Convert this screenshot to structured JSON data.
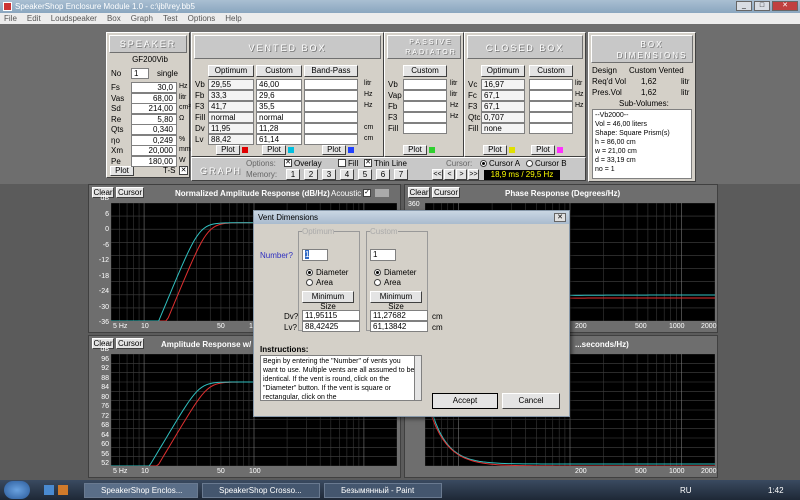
{
  "window": {
    "title": "SpeakerShop Enclosure Module 1.0 - c:\\jbl\\rey.bb5"
  },
  "menu": [
    "File",
    "Edit",
    "Loudspeaker",
    "Box",
    "Graph",
    "Test",
    "Options",
    "Help"
  ],
  "speaker": {
    "header": "SPEAKER",
    "name": "GF200Vib",
    "no_label": "No",
    "no_val": "1",
    "single": "single",
    "params": [
      {
        "k": "Fs",
        "v": "30,0",
        "u": "Hz"
      },
      {
        "k": "Vas",
        "v": "68,00",
        "u": "litr"
      },
      {
        "k": "Sd",
        "v": "214,00",
        "u": "cm²"
      },
      {
        "k": "Re",
        "v": "5,80",
        "u": "Ω"
      },
      {
        "k": "Qts",
        "v": "0,340",
        "u": ""
      },
      {
        "k": "ηo",
        "v": "0,249",
        "u": "%"
      },
      {
        "k": "Xm",
        "v": "20,000",
        "u": "mm"
      },
      {
        "k": "Pe",
        "v": "180,00",
        "u": "W"
      }
    ],
    "plot": "Plot",
    "ts": "T-S"
  },
  "vented": {
    "header": "VENTED BOX",
    "optimum": "Optimum",
    "custom": "Custom",
    "bandpass": "Band-Pass",
    "rows": [
      {
        "k": "Vb",
        "o": "29,55",
        "c": "46,00",
        "u": "litr"
      },
      {
        "k": "Fb",
        "o": "33,3",
        "c": "29,6",
        "u": "Hz"
      },
      {
        "k": "F3",
        "o": "41,7",
        "c": "35,5",
        "u": "Hz"
      },
      {
        "k": "Fill",
        "o": "normal",
        "c": "normal",
        "u": ""
      },
      {
        "k": "Dv",
        "o": "11,95",
        "c": "11,28",
        "u": "cm"
      },
      {
        "k": "Lv",
        "o": "88,42",
        "c": "61,14",
        "u": "cm"
      }
    ],
    "plot": "Plot"
  },
  "passive": {
    "header": "PASSIVE RADIATOR",
    "custom": "Custom",
    "rows": [
      {
        "k": "Vb",
        "u": "litr"
      },
      {
        "k": "Vap",
        "u": "litr"
      },
      {
        "k": "Fb",
        "u": "Hz"
      },
      {
        "k": "F3",
        "u": "Hz"
      },
      {
        "k": "Fill",
        "u": ""
      }
    ],
    "plot": "Plot"
  },
  "closed": {
    "header": "CLOSED BOX",
    "optimum": "Optimum",
    "custom": "Custom",
    "rows": [
      {
        "k": "Vc",
        "o": "16,97",
        "c": "",
        "u": "litr"
      },
      {
        "k": "Fc",
        "o": "67,1",
        "c": "",
        "u": "Hz"
      },
      {
        "k": "F3",
        "o": "67,1",
        "c": "",
        "u": "Hz"
      },
      {
        "k": "Qtc",
        "o": "0,707",
        "c": "",
        "u": ""
      },
      {
        "k": "Fill",
        "o": "none",
        "c": "",
        "u": ""
      }
    ],
    "plot": "Plot"
  },
  "boxdims": {
    "header": "BOX DIMENSIONS",
    "design": "Design",
    "design_val": "Custom Vented",
    "reqd": "Req'd Vol",
    "reqd_val": "1,62",
    "reqd_u": "litr",
    "pres": "Pres.Vol",
    "pres_val": "1,62",
    "pres_u": "litr",
    "subvol": "Sub-Volumes:",
    "lines": [
      "--Vb2000--",
      "Vol = 46,00 liters",
      "Shape: Square Prism(s)",
      "h = 86,00 cm",
      "w = 21,00 cm",
      "d = 33,19 cm",
      "no = 1"
    ]
  },
  "graphbar": {
    "label": "GRAPH",
    "options": "Options:",
    "overlay": "Overlay",
    "fill": "Fill",
    "thin": "Thin Line",
    "memory": "Memory:",
    "mem": [
      "1",
      "2",
      "3",
      "4",
      "5",
      "6",
      "7"
    ],
    "cursor": "Cursor:",
    "ca": "Cursor A",
    "cb": "Cursor B",
    "nav": [
      "<<",
      "<",
      ">",
      ">>"
    ],
    "readout": "18,9 ms / 29,5 Hz"
  },
  "graphs": {
    "clear": "Clear",
    "cursor": "Cursor",
    "g1": {
      "title": "Normalized Amplitude Response (dB/Hz)",
      "acoustic": "Acoustic",
      "y": [
        "dB",
        "6",
        "0",
        "-6",
        "-12",
        "-18",
        "-24",
        "-30",
        "-36"
      ],
      "x": [
        "5 Hz",
        "10",
        "50",
        "100"
      ]
    },
    "g2": {
      "title": "Phase Response (Degrees/Hz)",
      "y": "360",
      "x": [
        "200",
        "500",
        "1000",
        "2000"
      ]
    },
    "g3": {
      "title": "Amplitude Response w/ 2...",
      "y": [
        "dB",
        "96",
        "92",
        "88",
        "84",
        "80",
        "76",
        "72",
        "68",
        "64",
        "60",
        "56",
        "52"
      ],
      "x": [
        "5 Hz",
        "10",
        "50",
        "100"
      ]
    },
    "g4": {
      "title": "...seconds/Hz)",
      "x": [
        "200",
        "500",
        "1000",
        "2000"
      ]
    }
  },
  "dialog": {
    "title": "Vent Dimensions",
    "optimum": "Optimum",
    "custom": "Custom",
    "number_label": "Number?",
    "opt_num": "1",
    "cust_num": "1",
    "diameter": "Diameter",
    "area": "Area",
    "minsize": "Minimum Size",
    "dv_label": "Dv?",
    "lv_label": "Lv?",
    "dv_opt": "11,95115",
    "lv_opt": "88,42425",
    "dv_cust": "11,27682",
    "lv_cust": "61,13842",
    "cm": "cm",
    "instructions_label": "Instructions:",
    "instructions": "Begin by entering the \"Number\" of vents you want to use. Multiple vents are all assumed to be identical. If the vent is round, click on the \"Diameter\" button. If the vent is square or rectangular, click on the",
    "accept": "Accept",
    "cancel": "Cancel"
  },
  "taskbar": {
    "tasks": [
      "SpeakerShop Enclos...",
      "SpeakerShop Crosso...",
      "Безымянный - Paint"
    ],
    "lang": "RU",
    "time": "1:42"
  },
  "colors": {
    "curve_red": "#e03030",
    "curve_cyan": "#30c0c0",
    "plot_red": "#e00000",
    "plot_cyan": "#00c0e0",
    "plot_blue": "#2040ff",
    "plot_yellow": "#e0e000"
  }
}
